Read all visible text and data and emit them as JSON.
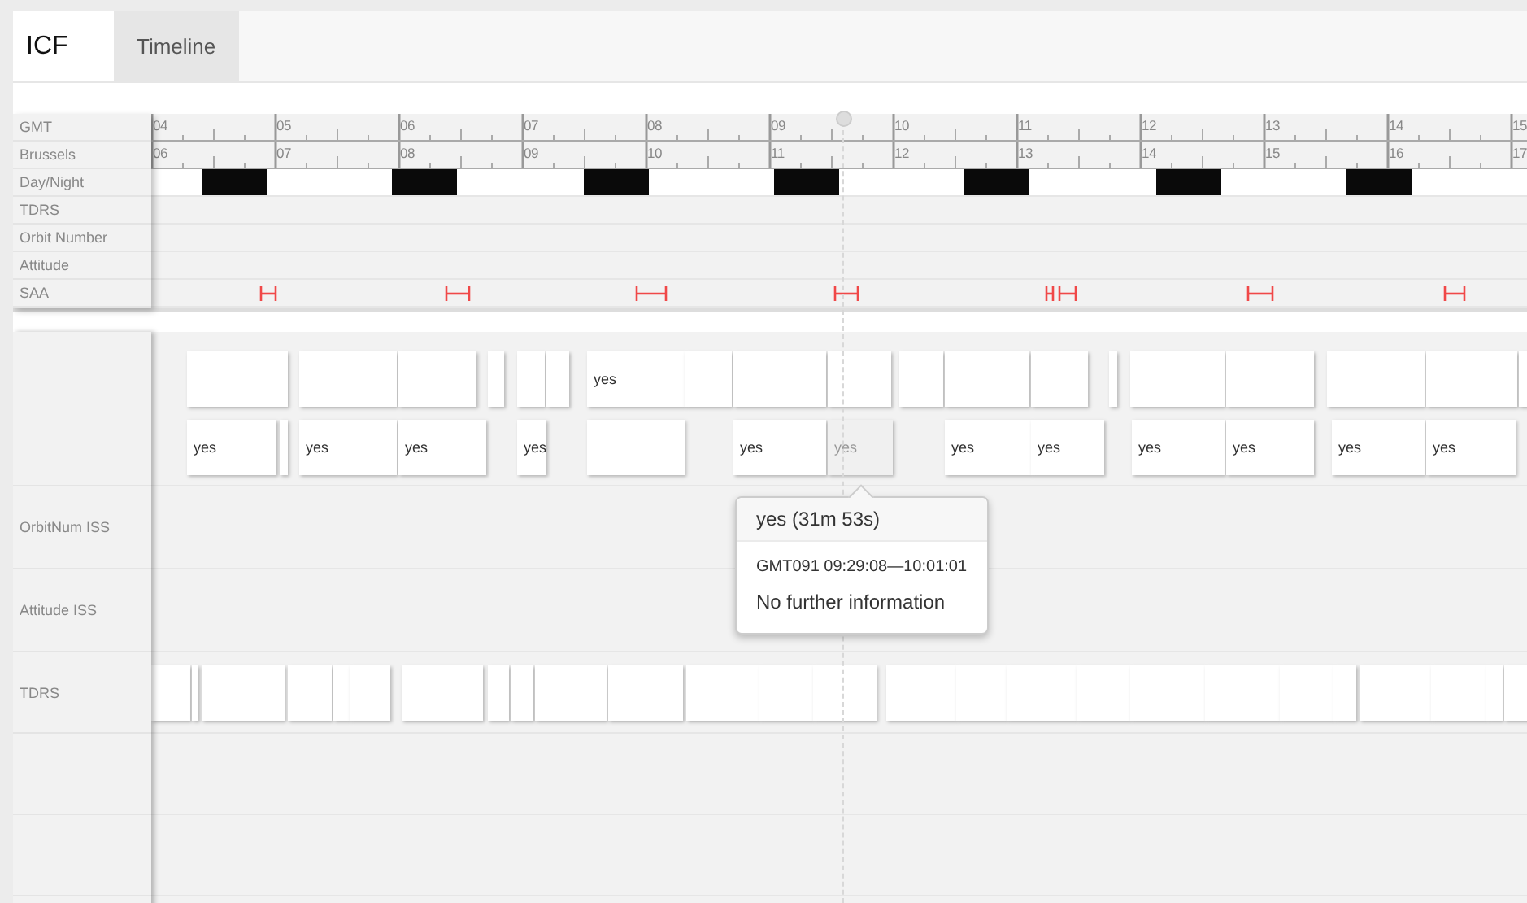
{
  "header": {
    "logo": "ICF",
    "tabs": [
      {
        "label": "Timeline",
        "selected": true
      }
    ]
  },
  "ruler": {
    "rows": [
      {
        "kind": "gmt",
        "label": "GMT"
      },
      {
        "kind": "local",
        "label": "Brussels"
      },
      {
        "kind": "daynight",
        "label": "Day/Night"
      },
      {
        "kind": "plain",
        "label": "TDRS"
      },
      {
        "kind": "plain",
        "label": "Orbit Number"
      },
      {
        "kind": "plain",
        "label": "Attitude"
      },
      {
        "kind": "saa",
        "label": "SAA"
      }
    ],
    "gmt_hours": [
      "04",
      "05",
      "06",
      "07",
      "08",
      "09",
      "10",
      "11",
      "12",
      "13",
      "14",
      "15"
    ],
    "local_hours": [
      "06",
      "07",
      "08",
      "09",
      "10",
      "11",
      "12",
      "13",
      "14",
      "15",
      "16",
      "17"
    ]
  },
  "swimlanes": [
    {
      "kind": "blocks",
      "lanes": [
        {
          "blocks": [
            {
              "kind": "blank"
            },
            {
              "kind": "blank"
            },
            {
              "kind": "blank"
            },
            {
              "kind": "blank"
            },
            {
              "kind": "blank"
            },
            {
              "kind": "blank"
            },
            {
              "kind": "text",
              "label": "yes"
            },
            {
              "kind": "blank"
            },
            {
              "kind": "blank"
            },
            {
              "kind": "blank"
            },
            {
              "kind": "blank"
            },
            {
              "kind": "blank"
            },
            {
              "kind": "blank"
            },
            {
              "kind": "blank"
            },
            {
              "kind": "blank"
            },
            {
              "kind": "blank"
            },
            {
              "kind": "blank"
            },
            {
              "kind": "blank"
            },
            {
              "kind": "blank"
            }
          ]
        },
        {
          "blocks": [
            {
              "kind": "text",
              "label": "yes",
              "hovered": false
            },
            {
              "kind": "blank",
              "hovered": false
            },
            {
              "kind": "text",
              "label": "yes",
              "hovered": false
            },
            {
              "kind": "text",
              "label": "yes",
              "hovered": false
            },
            {
              "kind": "text",
              "label": "yes",
              "hovered": false
            },
            {
              "kind": "blank",
              "hovered": false
            },
            {
              "kind": "text",
              "label": "yes",
              "hovered": false
            },
            {
              "kind": "text",
              "label": "yes",
              "hovered": true
            },
            {
              "kind": "text",
              "label": "yes",
              "hovered": false
            },
            {
              "kind": "text",
              "label": "yes",
              "hovered": false
            },
            {
              "kind": "text",
              "label": "yes",
              "hovered": false
            },
            {
              "kind": "text",
              "label": "yes",
              "hovered": false
            },
            {
              "kind": "text",
              "label": "yes",
              "hovered": false
            },
            {
              "kind": "text",
              "label": "yes",
              "hovered": false
            }
          ]
        }
      ]
    },
    {
      "kind": "empty",
      "label": "OrbitNum ISS"
    },
    {
      "kind": "empty",
      "label": "Attitude ISS"
    },
    {
      "kind": "blocks",
      "label": "TDRS",
      "lanes": [
        {
          "blocks": [
            {
              "kind": "blank"
            },
            {
              "kind": "blank"
            },
            {
              "kind": "blank"
            },
            {
              "kind": "blank"
            },
            {
              "kind": "blank"
            },
            {
              "kind": "blank"
            },
            {
              "kind": "blank"
            },
            {
              "kind": "blank"
            },
            {
              "kind": "blank"
            },
            {
              "kind": "blank"
            },
            {
              "kind": "blank"
            },
            {
              "kind": "blank"
            },
            {
              "kind": "blank"
            },
            {
              "kind": "blank"
            },
            {
              "kind": "blank"
            },
            {
              "kind": "blank"
            },
            {
              "kind": "blank"
            },
            {
              "kind": "blank"
            },
            {
              "kind": "blank"
            },
            {
              "kind": "blank"
            },
            {
              "kind": "blank"
            },
            {
              "kind": "blank"
            },
            {
              "kind": "blank"
            },
            {
              "kind": "blank"
            },
            {
              "kind": "blank"
            },
            {
              "kind": "blank"
            }
          ]
        }
      ]
    },
    {
      "kind": "empty"
    },
    {
      "kind": "empty"
    }
  ],
  "tooltip": {
    "title": "yes (31m 53s)",
    "range": "GMT091 09:29:08—10:01:01",
    "info": "No further information"
  }
}
